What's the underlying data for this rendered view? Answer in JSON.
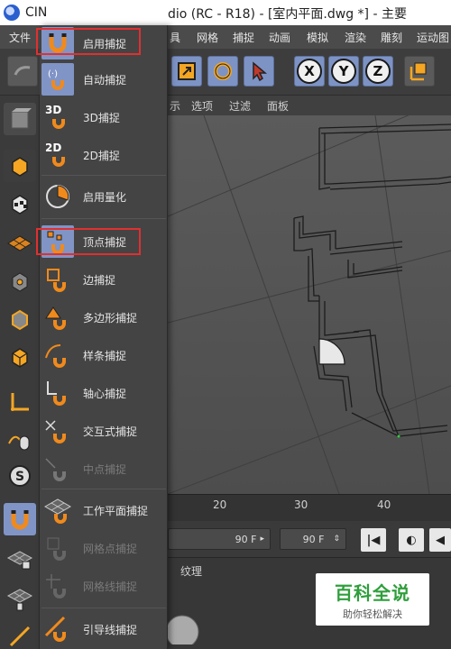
{
  "titlebar": {
    "left_text": "CIN",
    "right_text": "dio (RC - R18) - [室内平面.dwg *] - 主要"
  },
  "menubar": {
    "items": [
      "文件",
      "具",
      "网格",
      "捕捉",
      "动画",
      "模拟",
      "渲染",
      "雕刻",
      "运动图"
    ]
  },
  "toolbar": {
    "axes": [
      "X",
      "Y",
      "Z"
    ]
  },
  "viewport_menu": {
    "items": [
      "示",
      "选项",
      "过滤",
      "面板"
    ]
  },
  "snap_menu": {
    "items": [
      {
        "label": "启用捕捉",
        "icon": "magnet-icon",
        "enabled": true,
        "highlighted": true
      },
      {
        "label": "自动捕捉",
        "icon": "auto-snap-icon",
        "enabled": true
      },
      {
        "label": "3D捕捉",
        "icon": "3d-snap-icon",
        "enabled": true,
        "badge": "3D"
      },
      {
        "label": "2D捕捉",
        "icon": "2d-snap-icon",
        "enabled": true,
        "badge": "2D"
      },
      {
        "label": "启用量化",
        "icon": "quantize-icon",
        "enabled": true
      },
      {
        "label": "顶点捕捉",
        "icon": "vertex-snap-icon",
        "enabled": true,
        "highlighted": true
      },
      {
        "label": "边捕捉",
        "icon": "edge-snap-icon",
        "enabled": true
      },
      {
        "label": "多边形捕捉",
        "icon": "polygon-snap-icon",
        "enabled": true
      },
      {
        "label": "样条捕捉",
        "icon": "spline-snap-icon",
        "enabled": true
      },
      {
        "label": "轴心捕捉",
        "icon": "axis-snap-icon",
        "enabled": true
      },
      {
        "label": "交互式捕捉",
        "icon": "intersection-snap-icon",
        "enabled": true
      },
      {
        "label": "中点捕捉",
        "icon": "midpoint-snap-icon",
        "enabled": false
      },
      {
        "label": "工作平面捕捉",
        "icon": "workplane-snap-icon",
        "enabled": true
      },
      {
        "label": "网格点捕捉",
        "icon": "grid-point-snap-icon",
        "enabled": false
      },
      {
        "label": "网格线捕捉",
        "icon": "grid-line-snap-icon",
        "enabled": false
      },
      {
        "label": "引导线捕捉",
        "icon": "guide-snap-icon",
        "enabled": true
      }
    ]
  },
  "timeline": {
    "ticks": [
      "20",
      "30",
      "40"
    ]
  },
  "transport": {
    "end_frame": "90 F",
    "preview_end": "90 F"
  },
  "materials": {
    "tab_label": "纹理"
  },
  "watermark": {
    "title": "百科全说",
    "subtitle": "助你轻松解决"
  },
  "colors": {
    "highlight_box": "#e03030",
    "active_blue": "#7d93c4",
    "magnet_orange": "#f08a1c"
  }
}
